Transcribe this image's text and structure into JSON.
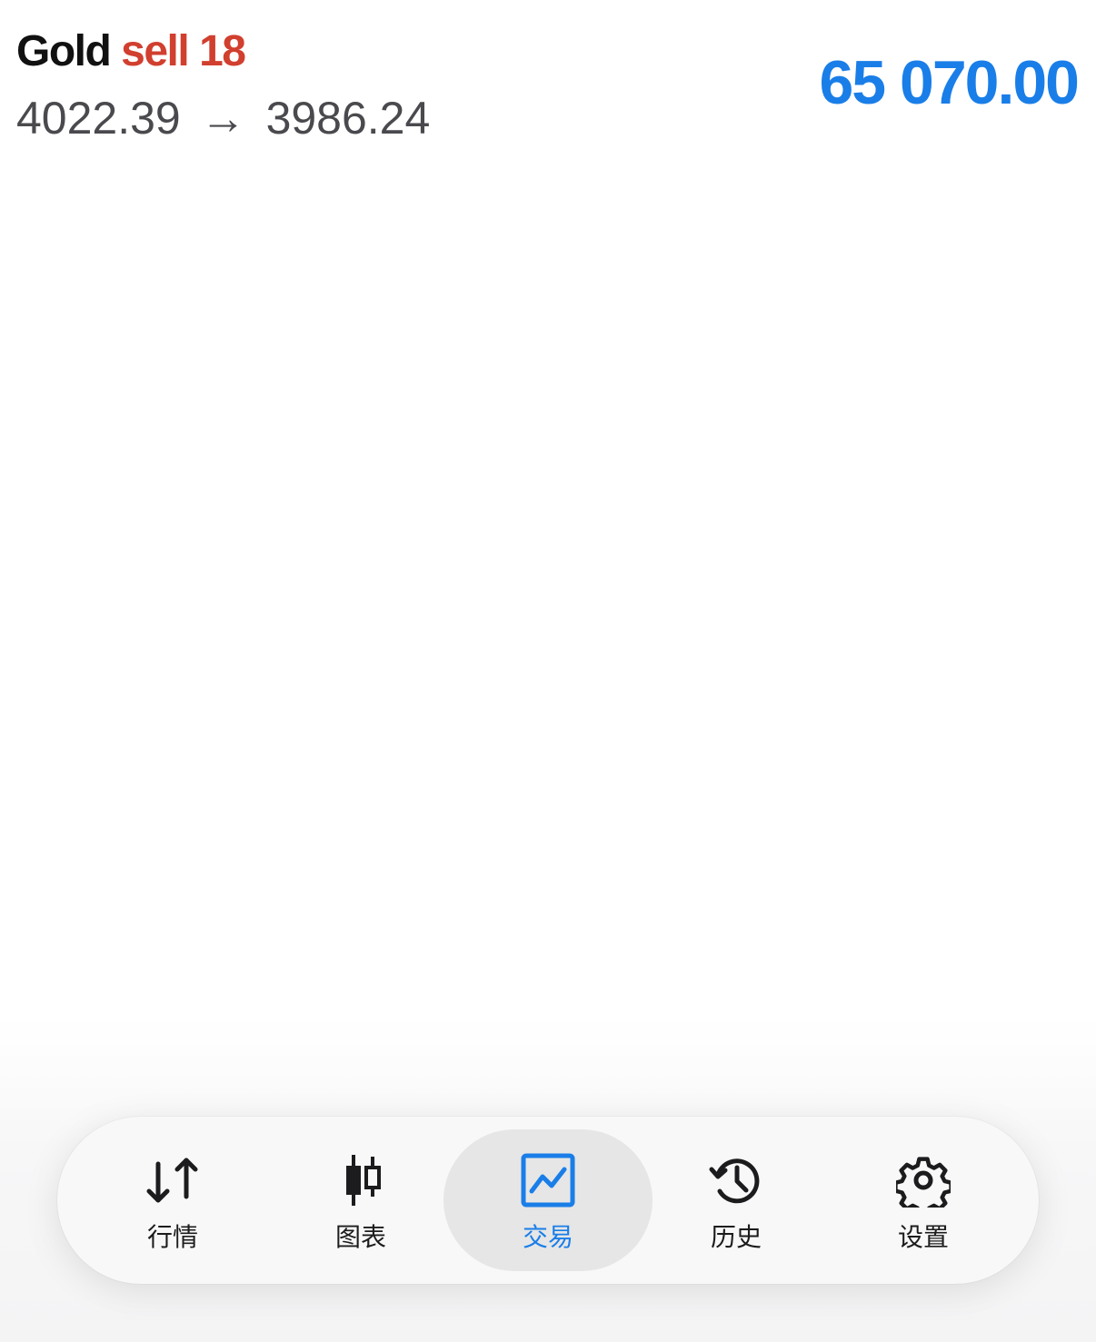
{
  "trade": {
    "symbol": "Gold",
    "direction": "sell",
    "volume": "18",
    "open_price": "4022.39",
    "arrow": "→",
    "current_price": "3986.24",
    "profit": "65 070.00"
  },
  "colors": {
    "accent": "#1a7ee8",
    "sell": "#d13f2f",
    "price_text": "#4a4a4e",
    "tab_active_bg": "#e6e6e6"
  },
  "tabbar": {
    "active": "trade",
    "items": [
      {
        "id": "quotes",
        "label": "行情",
        "icon": "arrows-up-down-icon"
      },
      {
        "id": "chart",
        "label": "图表",
        "icon": "candlestick-icon"
      },
      {
        "id": "trade",
        "label": "交易",
        "icon": "line-chart-icon"
      },
      {
        "id": "history",
        "label": "历史",
        "icon": "history-icon"
      },
      {
        "id": "settings",
        "label": "设置",
        "icon": "gear-icon"
      }
    ]
  }
}
